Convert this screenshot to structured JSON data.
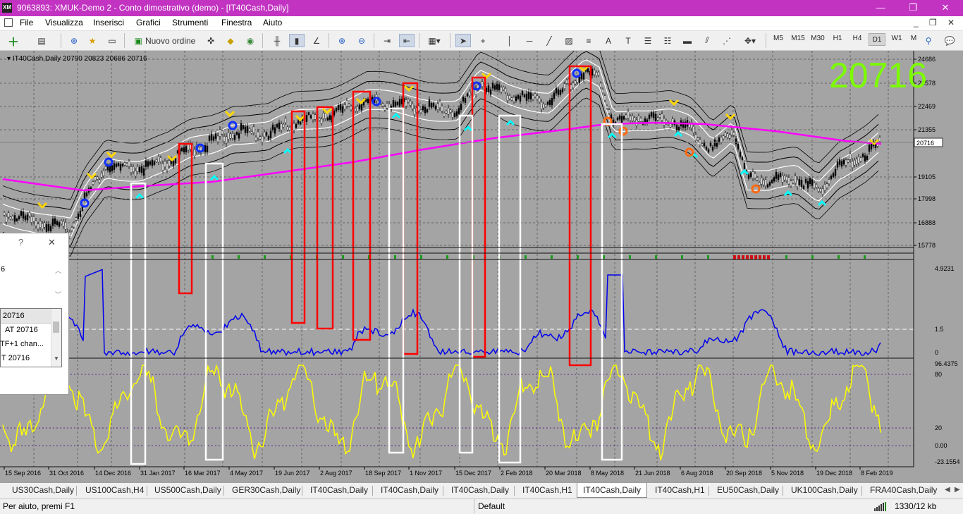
{
  "window": {
    "logo": "XM",
    "title": "9063893: XMUK-Demo 2 - Conto dimostrativo (demo) - [IT40Cash,Daily]",
    "btn_min": "—",
    "btn_restore": "❐",
    "btn_close": "✕"
  },
  "menu": {
    "items": [
      "File",
      "Visualizza",
      "Inserisci",
      "Grafici",
      "Strumenti",
      "Finestra",
      "Aiuto"
    ],
    "ctrl_min": "_",
    "ctrl_restore": "❐",
    "ctrl_close": "✕"
  },
  "toolbar": {
    "new_order": "Nuovo ordine",
    "timeframes": [
      "M5",
      "M15",
      "M30",
      "H1",
      "H4",
      "D1",
      "W1",
      "M"
    ],
    "active_timeframe": "D1"
  },
  "chart": {
    "header": "IT40Cash,Daily  20790 20823 20686 20716",
    "big_price": "20716",
    "big_price_color": "#7cfc00",
    "current_price_label": "20716",
    "price_axis": [
      "24686",
      "23578",
      "22469",
      "21355",
      "20716",
      "19105",
      "17998",
      "16888",
      "15778"
    ],
    "indicator1_axis": [
      "4.9231",
      "1.5",
      "0"
    ],
    "indicator2_axis": [
      "96.4375",
      "80",
      "20",
      "0.00",
      "-23.1554"
    ],
    "date_labels": [
      "15 Sep 2016",
      "31 Oct 2016",
      "14 Dec 2016",
      "31 Jan 2017",
      "16 Mar 2017",
      "4 May 2017",
      "19 Jun 2017",
      "2 Aug 2017",
      "18 Sep 2017",
      "1 Nov 2017",
      "15 Dec 2017",
      "2 Feb 2018",
      "20 Mar 2018",
      "8 May 2018",
      "21 Jun 2018",
      "6 Aug 2018",
      "20 Sep 2018",
      "5 Nov 2018",
      "19 Dec 2018",
      "8 Feb 2019"
    ],
    "colors": {
      "background": "#a4a4a4",
      "moving_average": "#ff00ff",
      "indicator1_line": "#0000ee",
      "indicator2_line": "#ffff00",
      "red_box": "#ff0000",
      "white_box": "#ffffff"
    }
  },
  "dialog": {
    "help": "?",
    "close": "✕",
    "value": "6",
    "scroll_up": "︿",
    "scroll_down": "﹀",
    "list_items": [
      "20716",
      "AT 20716",
      "TF+1 chan...",
      "T 20716"
    ]
  },
  "tabs": {
    "items": [
      "US30Cash,Daily",
      "US100Cash,H4",
      "US500Cash,Daily",
      "GER30Cash,Daily",
      "IT40Cash,Daily",
      "IT40Cash,Daily",
      "IT40Cash,Daily",
      "IT40Cash,H1",
      "IT40Cash,Daily",
      "IT40Cash,H1",
      "EU50Cash,Daily",
      "UK100Cash,Daily",
      "FRA40Cash,Daily"
    ],
    "active_index": 8,
    "nav_prev": "◀",
    "nav_next": "▶"
  },
  "status": {
    "help_text": "Per aiuto, premi F1",
    "profile": "Default",
    "traffic": "1330/12 kb"
  }
}
